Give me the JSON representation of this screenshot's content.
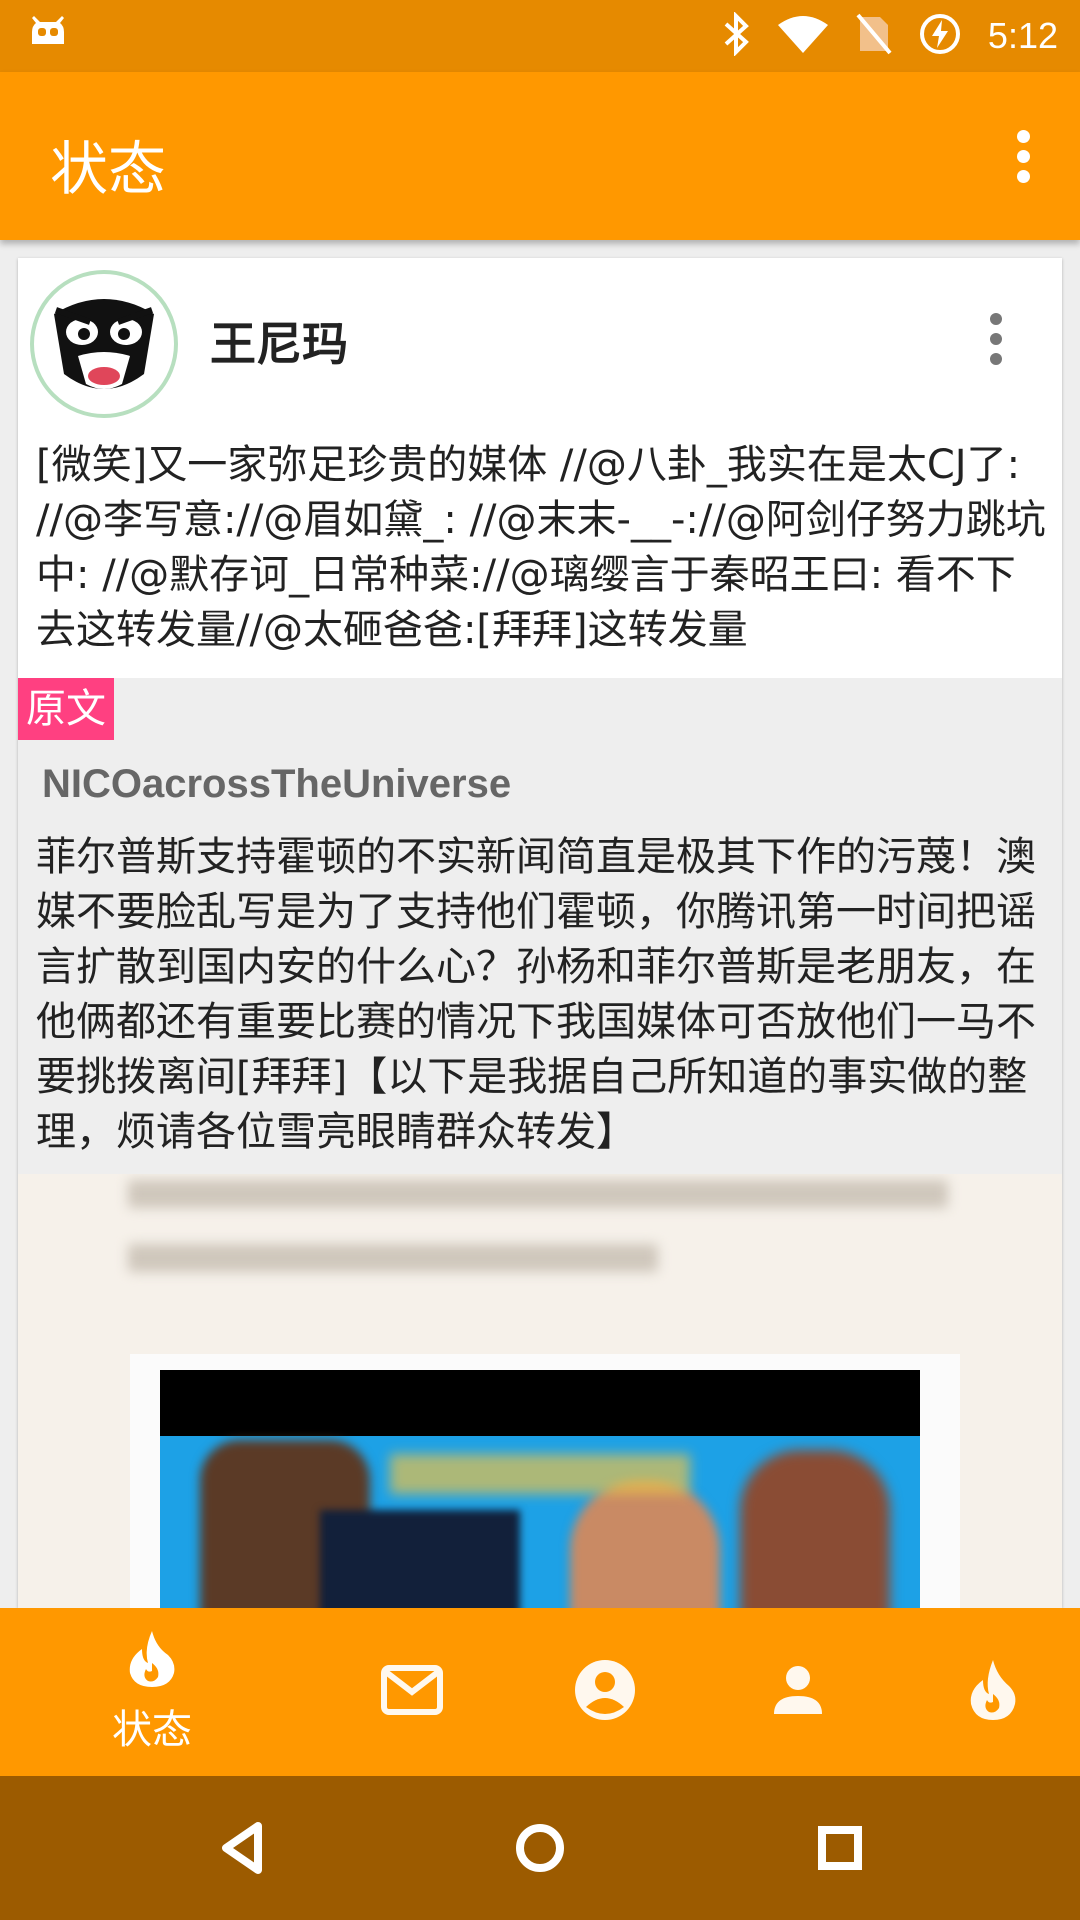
{
  "status_bar": {
    "time": "5:12",
    "icons": [
      "cyanogen-bot-icon",
      "bluetooth-icon",
      "wifi-icon",
      "no-sim-icon",
      "battery-charging-icon"
    ]
  },
  "app_bar": {
    "title": "状态",
    "menu_icon": "overflow-menu-icon"
  },
  "post": {
    "author": "王尼玛",
    "text": "[微笑]又一家弥足珍贵的媒体 //@八卦_我实在是太CJ了: //@李写意://@眉如黛_: //@末末-__-://@阿剑仔努力跳坑中: //@默存诃_日常种菜://@璃缨言于秦昭王曰: 看不下去这转发量//@太砸爸爸:[拜拜]这转发量",
    "original": {
      "badge": "原文",
      "user": "NICOacrossTheUniverse",
      "text": "菲尔普斯支持霍顿的不实新闻简直是极其下作的污蔑！澳媒不要脸乱写是为了支持他们霍顿，你腾讯第一时间把谣言扩散到国内安的什么心？孙杨和菲尔普斯是老朋友，在他俩都还有重要比赛的情况下我国媒体可否放他们一马不要挑拨离间[拜拜]【以下是我据自己所知道的事实做的整理，烦请各位雪亮眼睛群众转发】"
    }
  },
  "bottom_nav": {
    "items": [
      {
        "icon": "flame-icon",
        "label": "状态",
        "active": true
      },
      {
        "icon": "mail-icon",
        "label": ""
      },
      {
        "icon": "account-circle-icon",
        "label": ""
      },
      {
        "icon": "person-icon",
        "label": ""
      },
      {
        "icon": "flame-icon",
        "label": ""
      }
    ]
  },
  "colors": {
    "accent": "#ff9800",
    "status_bar": "#e68a00",
    "badge": "#ff4081",
    "system_nav": "#9c5b00"
  }
}
